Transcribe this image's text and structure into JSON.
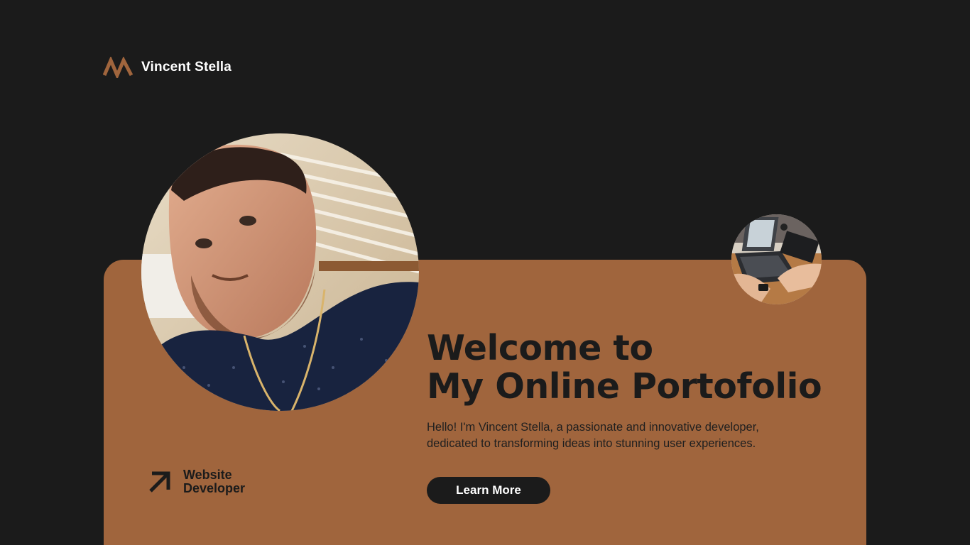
{
  "header": {
    "brand_name": "Vincent Stella",
    "logo_icon": "double-chevron-logo-icon"
  },
  "hero": {
    "heading_line1": "Welcome to",
    "heading_line2": "My Online Portofolio",
    "intro_line1": "Hello! I'm Vincent Stella, a passionate and innovative developer,",
    "intro_line2": "dedicated to transforming ideas into stunning user experiences.",
    "cta_label": "Learn More",
    "role_line1": "Website",
    "role_line2": "Developer",
    "role_icon": "arrow-up-right-icon"
  },
  "colors": {
    "background": "#1b1b1b",
    "accent": "#a0653d",
    "text_light": "#ffffff",
    "text_dark": "#1b1b1b"
  }
}
